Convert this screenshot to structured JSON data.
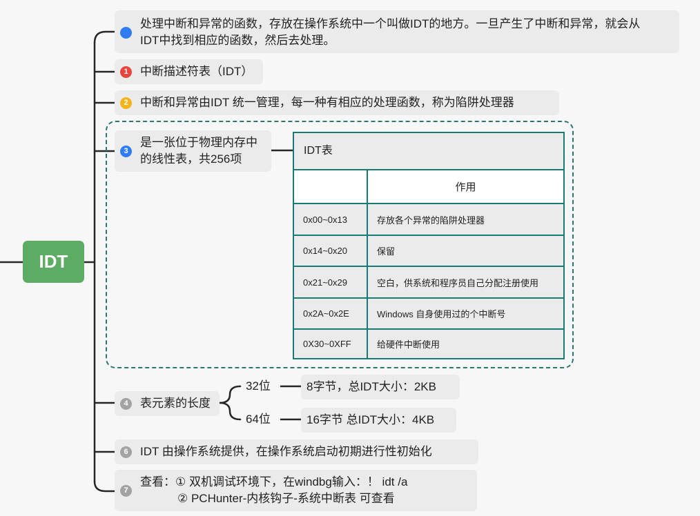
{
  "root": {
    "label": "IDT"
  },
  "branches": [
    {
      "bullet": "",
      "bullet_color": "#2f7df0",
      "lines": [
        "处理中断和异常的函数，存放在操作系统中一个叫做IDT的地方。一旦产生了中断和异常，就会从",
        "IDT中找到相应的函数，然后去处理。"
      ]
    },
    {
      "bullet": "1",
      "bullet_color": "#e8453c",
      "lines": [
        "中断描述符表（IDT）"
      ]
    },
    {
      "bullet": "2",
      "bullet_color": "#f5b51a",
      "lines": [
        "中断和异常由IDT 统一管理，每一种有相应的处理函数，称为陷阱处理器"
      ]
    },
    {
      "bullet": "3",
      "bullet_color": "#2f7df0",
      "lines": [
        "是一张位于物理内存中",
        "的线性表，共256项"
      ]
    },
    {
      "bullet": "4",
      "bullet_color": "#a3a3a3",
      "lines": [
        "表元素的长度"
      ]
    },
    {
      "bullet": "6",
      "bullet_color": "#a3a3a3",
      "lines": [
        "IDT 由操作系统提供，在操作系统启动初期进行性初始化"
      ]
    },
    {
      "bullet": "7",
      "bullet_color": "#a3a3a3",
      "lines": [
        "查看：① 双机调试环境下，在windbg输入：！ idt /a",
        "② PCHunter-内核钩子-系统中断表 可查看"
      ]
    }
  ],
  "table": {
    "title": "IDT表",
    "header": [
      "",
      "作用"
    ],
    "rows": [
      [
        "0x00~0x13",
        "存放各个异常的陷阱处理器"
      ],
      [
        "0x14~0x20",
        "保留"
      ],
      [
        "0x21~0x29",
        "空白，供系统和程序员自己分配注册使用"
      ],
      [
        "0x2A~0x2E",
        "Windows 自身使用过的个中断号"
      ],
      [
        "0X30~0XFF",
        "给硬件中断使用"
      ]
    ]
  },
  "length_items": [
    {
      "label": "32位",
      "detail": "8字节，总IDT大小：2KB"
    },
    {
      "label": "64位",
      "detail": "16字节 总IDT大小：4KB"
    }
  ]
}
